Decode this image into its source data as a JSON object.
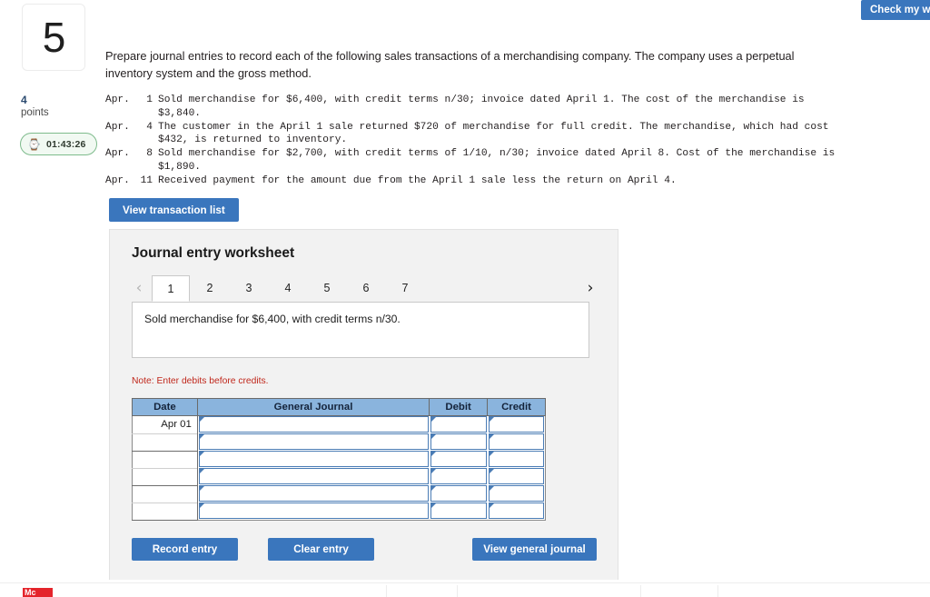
{
  "header": {
    "check_my_work_label": "Check my work"
  },
  "question": {
    "number": "5",
    "points_value": "4",
    "points_label": "points",
    "timer": "01:43:26",
    "timer_icon": "hourglass-icon",
    "prompt": "Prepare journal entries to record each of the following sales transactions of a merchandising company. The company uses a perpetual inventory system and the gross method.",
    "transactions": [
      {
        "month": "Apr.",
        "day": "1",
        "line1": "Sold merchandise for $6,400, with credit terms n/30; invoice dated April 1. The cost of the merchandise is",
        "line2": "$3,840."
      },
      {
        "month": "Apr.",
        "day": "4",
        "line1": "The customer in the April 1 sale returned $720 of merchandise for full credit. The merchandise, which had cost",
        "line2": "$432, is returned to inventory."
      },
      {
        "month": "Apr.",
        "day": "8",
        "line1": "Sold merchandise for $2,700, with credit terms of 1/10, n/30; invoice dated April 8. Cost of the merchandise is",
        "line2": "$1,890."
      },
      {
        "month": "Apr.",
        "day": "11",
        "line1": "Received payment for the amount due from the April 1 sale less the return on April 4.",
        "line2": ""
      }
    ],
    "view_transaction_list_label": "View transaction list"
  },
  "worksheet": {
    "title": "Journal entry worksheet",
    "prev_icon": "chevron-left-icon",
    "next_icon": "chevron-right-icon",
    "tabs": [
      {
        "label": "1",
        "active": true
      },
      {
        "label": "2",
        "active": false
      },
      {
        "label": "3",
        "active": false
      },
      {
        "label": "4",
        "active": false
      },
      {
        "label": "5",
        "active": false
      },
      {
        "label": "6",
        "active": false
      },
      {
        "label": "7",
        "active": false
      }
    ],
    "active_tab_description": "Sold merchandise for $6,400, with credit terms n/30.",
    "note": "Note: Enter debits before credits.",
    "table": {
      "columns": [
        "Date",
        "General Journal",
        "Debit",
        "Credit"
      ],
      "rows": [
        {
          "date": "Apr 01",
          "general_journal": "",
          "debit": "",
          "credit": ""
        },
        {
          "date": "",
          "general_journal": "",
          "debit": "",
          "credit": ""
        },
        {
          "date": "",
          "general_journal": "",
          "debit": "",
          "credit": ""
        },
        {
          "date": "",
          "general_journal": "",
          "debit": "",
          "credit": ""
        },
        {
          "date": "",
          "general_journal": "",
          "debit": "",
          "credit": ""
        },
        {
          "date": "",
          "general_journal": "",
          "debit": "",
          "credit": ""
        }
      ]
    },
    "actions": {
      "record_entry": "Record entry",
      "clear_entry": "Clear entry",
      "view_general_journal": "View general journal"
    }
  },
  "footer": {
    "logo_text": "Mc"
  },
  "colors": {
    "primary_blue": "#3a76bd",
    "table_header_blue": "#8ab4dd",
    "input_border_blue": "#4a7cb5",
    "note_red": "#c0271b",
    "timer_green": "#7ebb8c",
    "logo_red": "#e4242b"
  }
}
